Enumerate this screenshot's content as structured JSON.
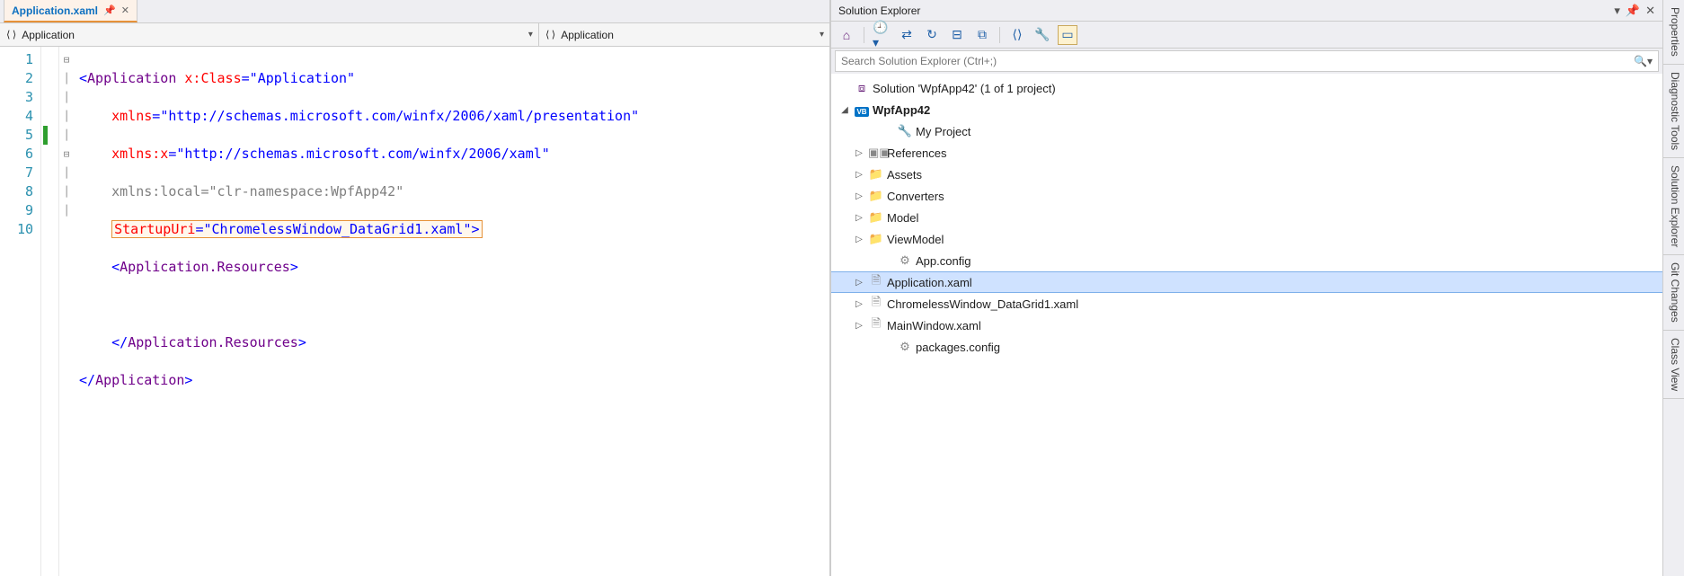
{
  "editor": {
    "tab": {
      "filename": "Application.xaml"
    },
    "dropdown_left": "Application",
    "dropdown_right": "Application",
    "line_numbers": [
      "1",
      "2",
      "3",
      "4",
      "5",
      "6",
      "7",
      "8",
      "9",
      "10"
    ],
    "code": {
      "l1": {
        "open": "<",
        "tag": "Application ",
        "attr": "x:Class",
        "eq": "=",
        "q1": "\"",
        "val": "Application",
        "q2": "\""
      },
      "l2": {
        "attr": "xmlns",
        "eq": "=",
        "q1": "\"",
        "val": "http://schemas.microsoft.com/winfx/2006/xaml/presentation",
        "q2": "\""
      },
      "l3": {
        "attr": "xmlns:x",
        "eq": "=",
        "q1": "\"",
        "val": "http://schemas.microsoft.com/winfx/2006/xaml",
        "q2": "\""
      },
      "l4": {
        "attr": "xmlns:local",
        "eq": "=",
        "q1": "\"",
        "val": "clr-namespace:WpfApp42",
        "q2": "\""
      },
      "l5": {
        "attr": "StartupUri",
        "eq": "=",
        "q1": "\"",
        "val": "ChromelessWindow_DataGrid1.xaml",
        "q2": "\"",
        "close": ">"
      },
      "l6": {
        "open": "<",
        "tag": "Application.Resources",
        "close": ">"
      },
      "l8": {
        "open": "</",
        "tag": "Application.Resources",
        "close": ">"
      },
      "l9": {
        "open": "</",
        "tag": "Application",
        "close": ">"
      }
    }
  },
  "solution_explorer": {
    "title": "Solution Explorer",
    "search_placeholder": "Search Solution Explorer (Ctrl+;)",
    "root": "Solution 'WpfApp42' (1 of 1 project)",
    "project": "WpfApp42",
    "items": {
      "my_project": "My Project",
      "references": "References",
      "assets": "Assets",
      "converters": "Converters",
      "model": "Model",
      "viewmodel": "ViewModel",
      "app_config": "App.config",
      "application_xaml": "Application.xaml",
      "chromeless": "ChromelessWindow_DataGrid1.xaml",
      "mainwindow": "MainWindow.xaml",
      "packages": "packages.config"
    }
  },
  "right_tabs": {
    "properties": "Properties",
    "diagnostic": "Diagnostic Tools",
    "solution_explorer": "Solution Explorer",
    "git_changes": "Git Changes",
    "class_view": "Class View"
  }
}
